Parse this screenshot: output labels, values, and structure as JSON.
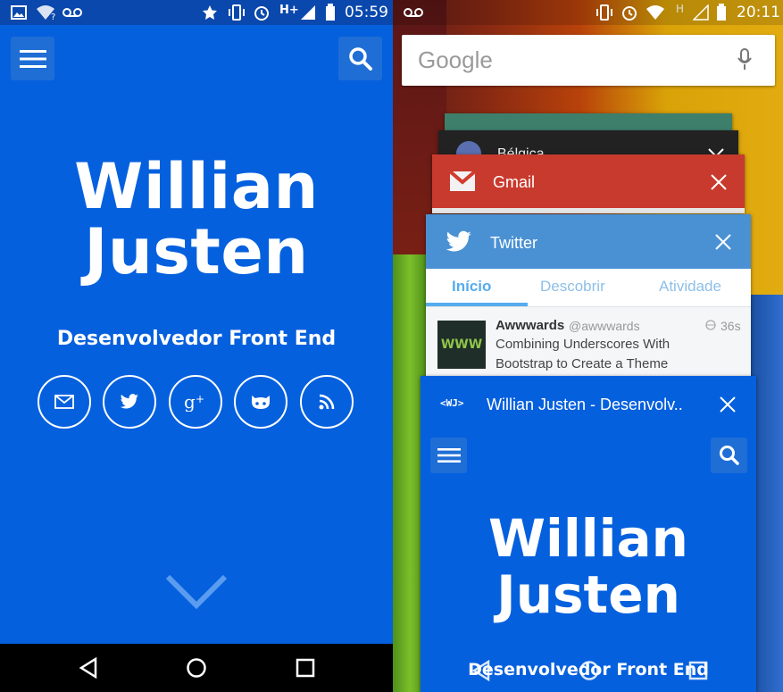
{
  "left": {
    "status": {
      "time": "05:59",
      "network": "H+"
    },
    "name_line1": "Willian",
    "name_line2": "Justen",
    "subtitle": "Desenvolvedor Front End",
    "social_icons": [
      "mail-icon",
      "twitter-icon",
      "google-plus-icon",
      "github-icon",
      "rss-icon"
    ],
    "accent": "#0560de"
  },
  "right": {
    "status": {
      "time": "20:11",
      "network": "H"
    },
    "google_logo": "Google",
    "cards": {
      "top_partial_title": "Bélgica",
      "gmail_title": "Gmail",
      "twitter_title": "Twitter",
      "twitter_tabs": [
        "Início",
        "Descobrir",
        "Atividade"
      ],
      "tweet_user": "Awwwards",
      "tweet_handle": "@awwwards",
      "tweet_time": "36s",
      "tweet_text_line1": "Combining Underscores With",
      "tweet_text_line2": "Bootstrap to Create a Theme",
      "tweet_avatar_text": "WWW",
      "site_badge": "<WJ>",
      "site_title": "Willian Justen - Desenvolv..",
      "site_name_line1": "Willian",
      "site_name_line2": "Justen",
      "site_subtitle": "Desenvolvedor Front End"
    },
    "colors": {
      "gmail": "#c93a2e",
      "twitter": "#4a91d4",
      "twitter_tab": "#55acee"
    }
  }
}
